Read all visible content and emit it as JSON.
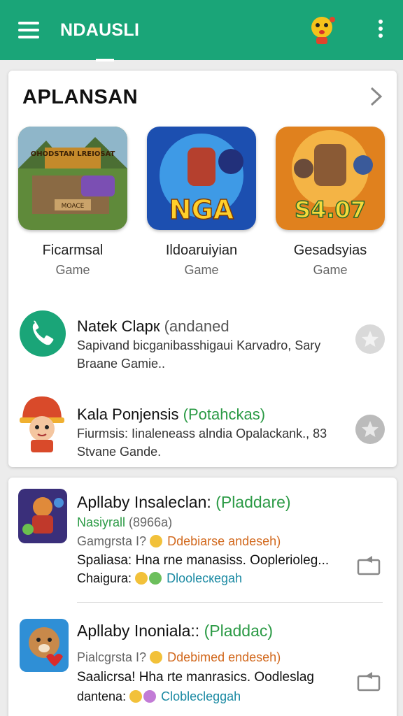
{
  "appbar": {
    "title": "NDAUSLI"
  },
  "section": {
    "title": "APLANSAN"
  },
  "featured": [
    {
      "name": "Ficarmsal",
      "category": "Game",
      "thumb_text_top": "OHODSTAN LREIOSAT",
      "thumb_text_bottom": "MOACE"
    },
    {
      "name": "Ildoaruiyian",
      "category": "Game",
      "thumb_text": "NGA"
    },
    {
      "name": "Gesadsyias",
      "category": "Game",
      "thumb_text": "S4.07"
    }
  ],
  "list1": [
    {
      "title": "Natek Clapк",
      "sub": "(andaned",
      "desc": "Sapivand bicganibasshigaui Karvadro, Sary Braane Gamie.."
    },
    {
      "title": "Kala Ponjensis",
      "sub": "(Potahckas)",
      "desc": "Fiurmsis: Iinaleneass alndia Opalackank., 83 Stvane Gande."
    }
  ],
  "list2": [
    {
      "title": "Apllaby Insaleclan:",
      "tag": "(Pladdare)",
      "line2_green": "Nasiyrall",
      "line2_gray": "(8966a)",
      "line3_prefix": "Gamgrsta I?",
      "line3_orange": "Ddebiarse andeseh)",
      "line4": "Spaliasa: Hna rne manasiss. Ooplerioleg...",
      "line5_prefix": "Chaigura:",
      "line5_teal": "Dloolecкegah"
    },
    {
      "title": "Apllaby Inoniala::",
      "tag": "(Pladdac)",
      "line3_prefix": "Pialcgrsta I?",
      "line3_orange": "Ddebimed endeseh)",
      "line4": "Saalicrsa! Hha rte manrasics. Oodleslag",
      "line5_prefix": "dantena:",
      "line5_teal": "Cloblecleggah"
    }
  ],
  "colors": {
    "appbar": "#1aa578",
    "accent_green": "#2b9a45",
    "orange": "#d2691e",
    "teal": "#1b8aa3"
  }
}
